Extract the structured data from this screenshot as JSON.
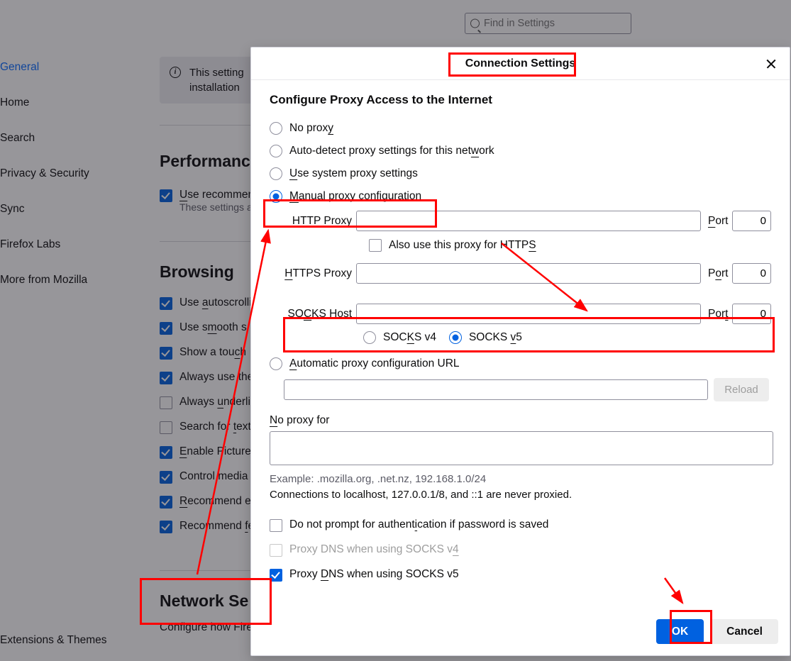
{
  "sidebar": {
    "items": [
      {
        "label": "General",
        "active": true
      },
      {
        "label": "Home"
      },
      {
        "label": "Search"
      },
      {
        "label": "Privacy & Security"
      },
      {
        "label": "Sync"
      },
      {
        "label": "Firefox Labs"
      },
      {
        "label": "More from Mozilla"
      }
    ],
    "footer": "Extensions & Themes"
  },
  "search": {
    "placeholder": "Find in Settings"
  },
  "banner": {
    "line1": "This setting",
    "line2": "installation"
  },
  "performance": {
    "title": "Performance",
    "use_recommended_pre": "U",
    "use_recommended_post": "se recommen",
    "subtext": "These settings ar"
  },
  "browsing": {
    "title": "Browsing",
    "items": [
      {
        "checked": true,
        "pre": "Use ",
        "u": "a",
        "mid": "utoscrolli"
      },
      {
        "checked": true,
        "pre": "Use s",
        "u": "m",
        "mid": "ooth s"
      },
      {
        "checked": true,
        "pre": "Show a tou",
        "u": "c",
        "mid": "h "
      },
      {
        "checked": true,
        "pre": "Always use the"
      },
      {
        "checked": false,
        "pre": "Always ",
        "u": "u",
        "mid": "nderlin"
      },
      {
        "checked": false,
        "pre": "Search for ",
        "u": "t",
        "mid": "ext "
      },
      {
        "checked": true,
        "pre": "",
        "u": "E",
        "mid": "nable Picture-"
      },
      {
        "checked": true,
        "pre": "Control media "
      },
      {
        "checked": true,
        "pre": "",
        "u": "R",
        "mid": "ecommend e"
      },
      {
        "checked": true,
        "pre": "Recommend ",
        "u": "f",
        "mid": "e"
      }
    ]
  },
  "network": {
    "title": "Network Se",
    "desc": "Configure how Fire"
  },
  "dialog": {
    "title": "Connection Settings",
    "heading": "Configure Proxy Access to the Internet",
    "radios": {
      "no_proxy": {
        "pre": "No prox",
        "u": "y"
      },
      "auto_detect": {
        "pre": "Auto-detect proxy settings for this net",
        "u": "w",
        "post": "ork"
      },
      "system": {
        "pre": "",
        "u": "U",
        "post": "se system proxy settings"
      },
      "manual": {
        "pre": "",
        "u": "M",
        "post": "anual proxy configuration"
      },
      "auto_url": {
        "pre": "",
        "u": "A",
        "post": "utomatic proxy configuration URL"
      }
    },
    "http": {
      "label_pre": "HTTP Pro",
      "label_u": "x",
      "label_post": "y",
      "port_label_u": "P",
      "port_label_post": "ort",
      "port": "0"
    },
    "also_https": {
      "pre": "Also use this proxy for HTTP",
      "u": "S"
    },
    "https": {
      "label_pre": "",
      "label_u": "H",
      "label_post": "TTPS Proxy",
      "port_label_pre": "P",
      "port_label_u": "o",
      "port_label_post": "rt",
      "port": "0"
    },
    "socks": {
      "label_pre": "SO",
      "label_u": "C",
      "label_post": "KS Host",
      "port_label_pre": "Por",
      "port_label_u": "t",
      "port": "0"
    },
    "socks_v4": {
      "pre": "SOC",
      "u": "K",
      "post": "S v4"
    },
    "socks_v5": {
      "pre": "SOCKS ",
      "u": "v",
      "post": "5"
    },
    "reload": "Reload",
    "no_proxy_for": {
      "pre": "",
      "u": "N",
      "post": "o proxy for"
    },
    "example": "Example: .mozilla.org, .net.nz, 192.168.1.0/24",
    "localhost": "Connections to localhost, 127.0.0.1/8, and ::1 are never proxied.",
    "auth": {
      "pre": "Do not prompt for authent",
      "u": "i",
      "post": "cation if password is saved"
    },
    "dns4": {
      "pre": "Proxy DNS when using SOCKS v",
      "u": "4"
    },
    "dns5": {
      "pre": "Proxy ",
      "u": "D",
      "post": "NS when using SOCKS v5"
    },
    "ok": "OK",
    "cancel": "Cancel"
  }
}
